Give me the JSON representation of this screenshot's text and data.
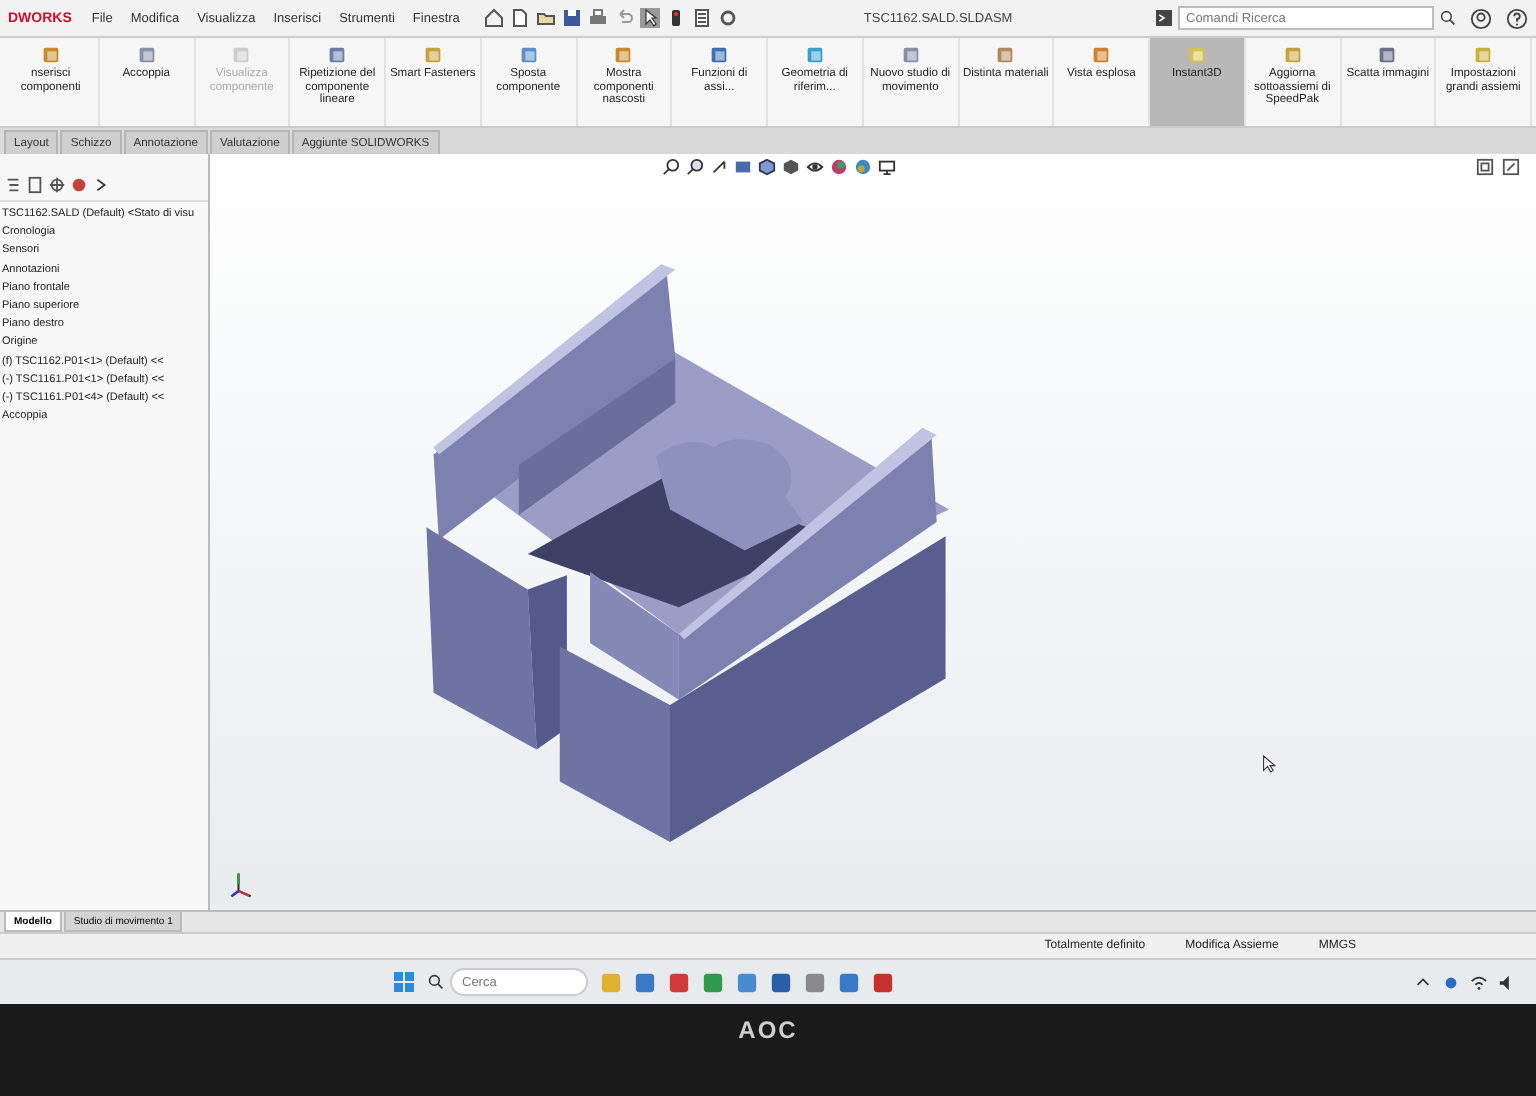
{
  "menu_bar": {
    "app_name": "DWORKS",
    "menus": [
      "File",
      "Modifica",
      "Visualizza",
      "Inserisci",
      "Strumenti",
      "Finestra"
    ],
    "document_title": "TSC1162.SALD.SLDASM",
    "search": {
      "placeholder": "Comandi Ricerca"
    }
  },
  "ribbon": {
    "buttons": [
      {
        "label": "nserisci componenti",
        "disabled": false,
        "selected": false
      },
      {
        "label": "Accoppia",
        "disabled": false,
        "selected": false
      },
      {
        "label": "Visualizza componente",
        "disabled": true,
        "selected": false
      },
      {
        "label": "Ripetizione del componente lineare",
        "disabled": false,
        "selected": false
      },
      {
        "label": "Smart Fasteners",
        "disabled": false,
        "selected": false
      },
      {
        "label": "Sposta componente",
        "disabled": false,
        "selected": false
      },
      {
        "label": "Mostra componenti nascosti",
        "disabled": false,
        "selected": false
      },
      {
        "label": "Funzioni di assi...",
        "disabled": false,
        "selected": false
      },
      {
        "label": "Geometria di riferim...",
        "disabled": false,
        "selected": false
      },
      {
        "label": "Nuovo studio di movimento",
        "disabled": false,
        "selected": false
      },
      {
        "label": "Distinta materiali",
        "disabled": false,
        "selected": false
      },
      {
        "label": "Vista esplosa",
        "disabled": false,
        "selected": false
      },
      {
        "label": "Instant3D",
        "disabled": false,
        "selected": true
      },
      {
        "label": "Aggiorna sottoassiemi di SpeedPak",
        "disabled": false,
        "selected": false
      },
      {
        "label": "Scatta immagini",
        "disabled": false,
        "selected": false
      },
      {
        "label": "Impostazioni grandi assiemi",
        "disabled": false,
        "selected": false
      }
    ]
  },
  "command_tabs": [
    {
      "label": "Layout",
      "selected": false
    },
    {
      "label": "Schizzo",
      "selected": false
    },
    {
      "label": "Annotazione",
      "selected": false
    },
    {
      "label": "Valutazione",
      "selected": false
    },
    {
      "label": "Aggiunte SOLIDWORKS",
      "selected": false
    }
  ],
  "feature_tree": {
    "items": [
      {
        "label": "TSC1162.SALD (Default) <Stato di visu",
        "children": [
          {
            "label": "Cronologia"
          },
          {
            "label": "Sensori"
          },
          {
            "label": "Annotazioni"
          },
          {
            "label": "Piano frontale"
          },
          {
            "label": "Piano superiore"
          },
          {
            "label": "Piano destro"
          },
          {
            "label": "Origine"
          },
          {
            "label": "(f) TSC1162.P01<1> (Default) <<"
          },
          {
            "label": "(-) TSC1161.P01<1> (Default) <<"
          },
          {
            "label": "(-) TSC1161.P01<4> (Default) <<"
          },
          {
            "label": "Accoppia"
          }
        ]
      }
    ]
  },
  "bottom_tabs": [
    {
      "label": "Modello",
      "selected": true
    },
    {
      "label": "Studio di movimento 1",
      "selected": false
    }
  ],
  "status_bar": {
    "items": [
      "Totalmente definito",
      "Modifica Assieme",
      "MMGS"
    ]
  },
  "taskbar": {
    "search": {
      "placeholder": "Cerca"
    }
  },
  "monitor": {
    "brand": "AOC"
  }
}
